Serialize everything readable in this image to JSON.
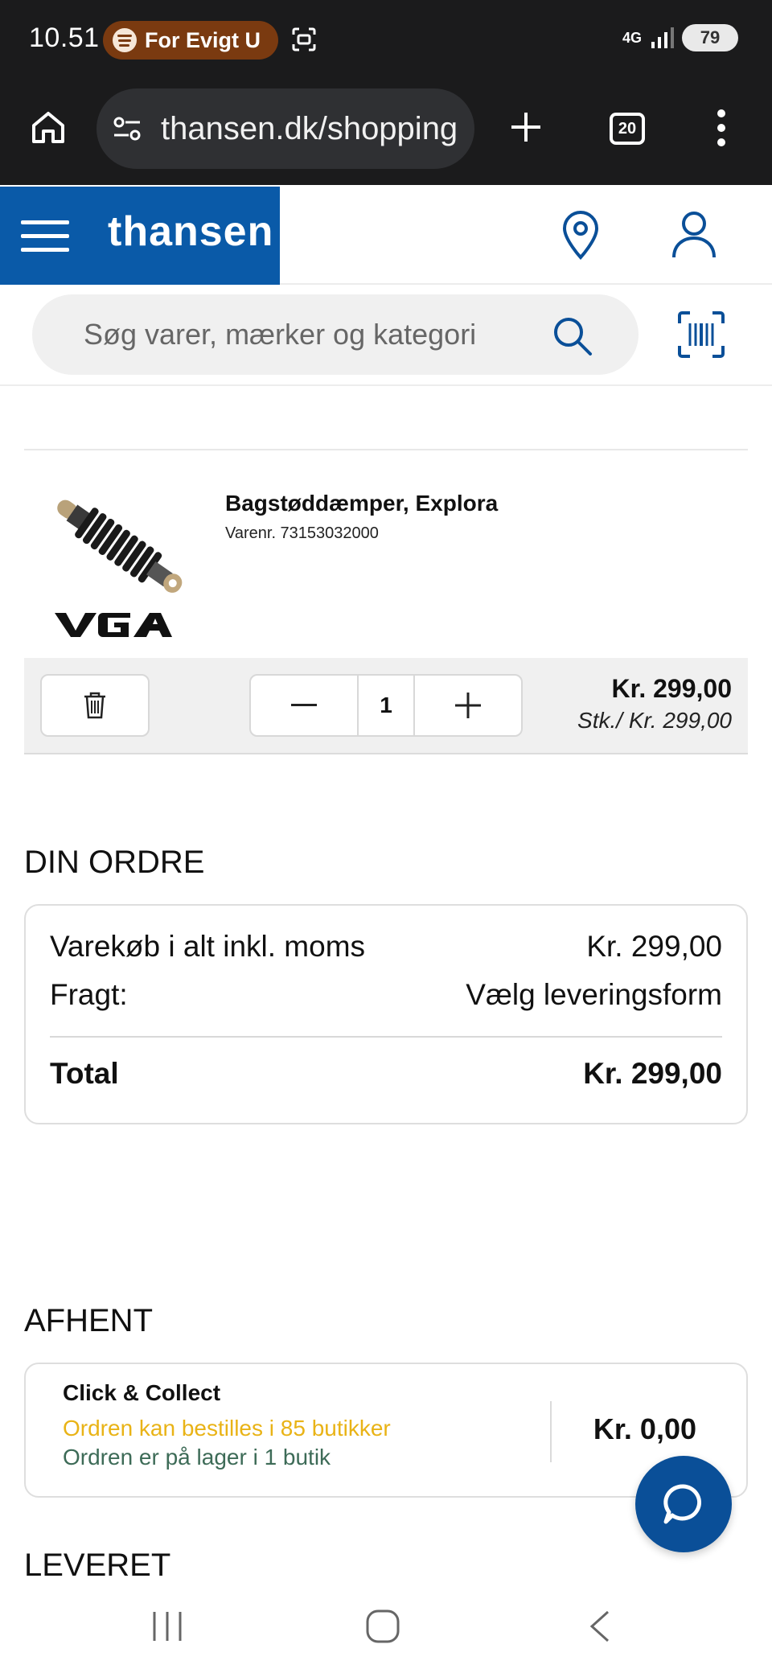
{
  "status_bar": {
    "time": "10.51",
    "media_label": "For Evigt U",
    "network": "4G",
    "battery": "79"
  },
  "browser": {
    "url": "thansen.dk/shopping",
    "tab_count": "20"
  },
  "header": {
    "logo": "thansen",
    "brand_color": "#0a5aa8"
  },
  "search": {
    "placeholder": "Søg varer, mærker og kategori"
  },
  "cart_item": {
    "name": "Bagstøddæmper, Explora",
    "sku": "Varenr. 73153032000",
    "brand": "VGA",
    "quantity": "1",
    "total_price": "Kr. 299,00",
    "unit_price": "Stk./ Kr. 299,00"
  },
  "order": {
    "title": "DIN ORDRE",
    "rows": [
      {
        "label": "Varekøb i alt inkl. moms",
        "value": "Kr. 299,00"
      },
      {
        "label": "Fragt:",
        "value": "Vælg leveringsform"
      }
    ],
    "total_label": "Total",
    "total_value": "Kr. 299,00"
  },
  "pickup": {
    "title": "AFHENT",
    "option_title": "Click & Collect",
    "availability_stores": "Ordren kan bestilles i 85 butikker",
    "availability_stock": "Ordren er på lager i 1 butik",
    "price": "Kr. 0,00",
    "colors": {
      "stores": "#e9b316",
      "stock": "#3d6b57"
    }
  },
  "delivery": {
    "title": "LEVERET"
  },
  "icons": [
    "home-icon",
    "tune-icon",
    "plus-icon",
    "tabs-icon",
    "more-icon",
    "menu-icon",
    "location-pin-icon",
    "user-icon",
    "search-icon",
    "barcode-icon",
    "trash-icon",
    "minus-icon",
    "chat-icon",
    "recent-apps-icon",
    "nav-home-icon",
    "back-icon"
  ]
}
